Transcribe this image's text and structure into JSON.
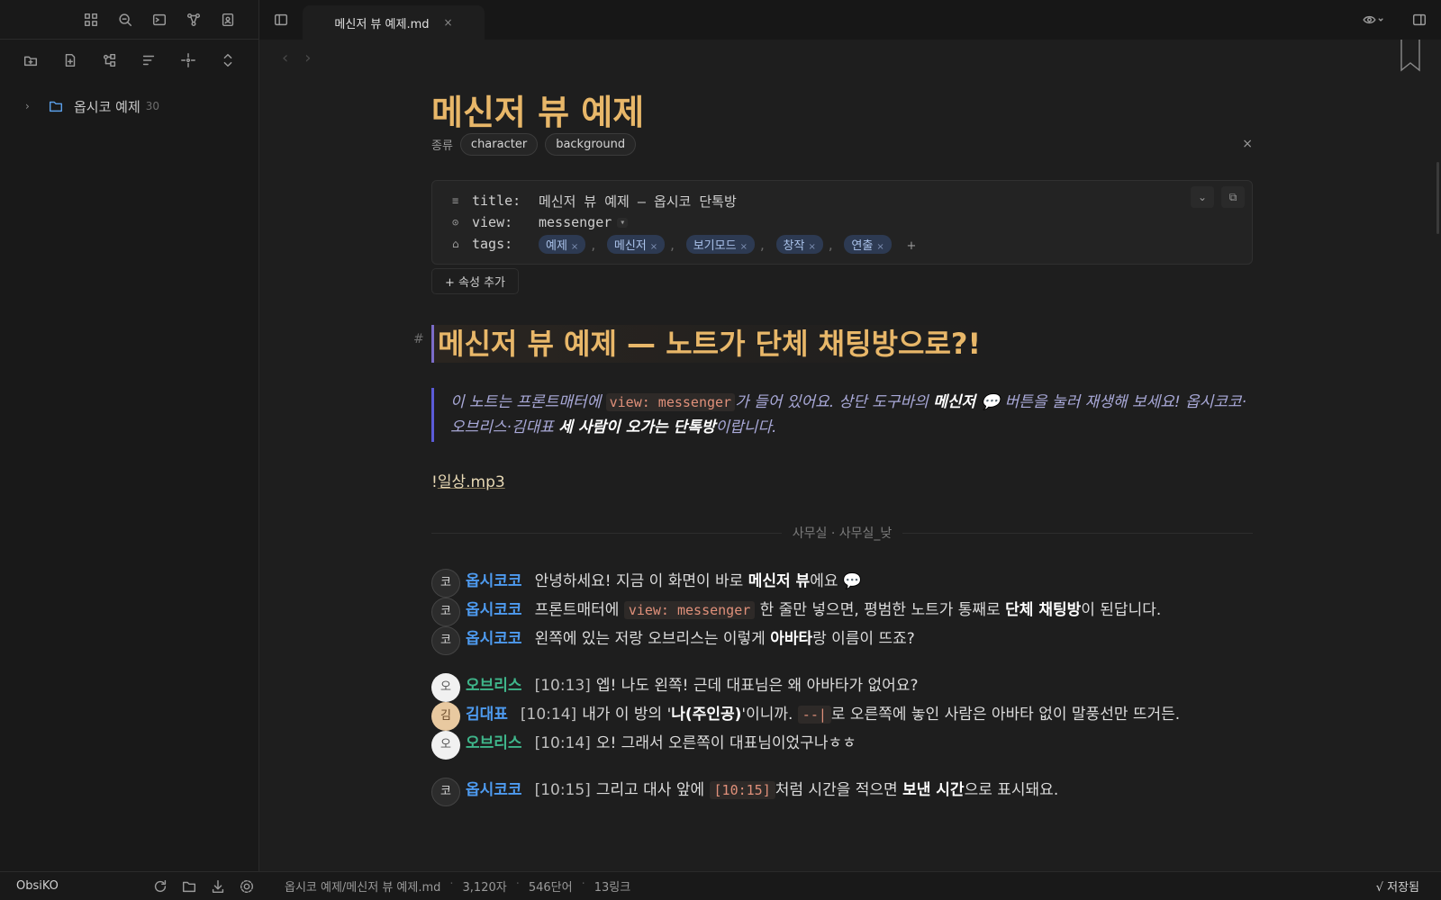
{
  "sidebar": {
    "ribbon_icons": [
      "dashboard-icon",
      "search-icon",
      "terminal-icon",
      "graph-icon",
      "profile-icon"
    ],
    "nav_icons": [
      "new-folder-icon",
      "new-note-icon",
      "canvas-icon",
      "sort-icon",
      "locate-icon",
      "collapse-icon"
    ],
    "tree": [
      {
        "name": "옵시코 예제",
        "count": "30"
      }
    ]
  },
  "tab": {
    "title": "메신저 뷰 예제.md",
    "close": "×"
  },
  "note": {
    "inline_title": "메신저 뷰 예제",
    "type_label": "종류",
    "type_pills": [
      "character",
      "background"
    ],
    "close_symbol": "×",
    "properties": {
      "title_key": "title:",
      "title_value": "메신저 뷰 예제 — 옵시코 단톡방",
      "view_key": "view:",
      "view_value": "messenger",
      "tags_key": "tags:",
      "tags": [
        "예제",
        "메신저",
        "보기모드",
        "창작",
        "연출"
      ],
      "tag_remove": "×",
      "tag_sep": ",",
      "tag_add": "+"
    },
    "add_property": "+ 속성 추가",
    "heading_hash": "#",
    "heading": "메신저 뷰 예제 — 노트가 단체 채팅방으로?!",
    "callout": {
      "part1": "이 노트는 프론트매터에 ",
      "code": "view: messenger",
      "part2": "가 들어 있어요. 상단 도구바의 ",
      "bold1": "메신저 💬",
      "part3": " 버튼을 눌러 재생해 보세요! 옵시코코·오브리스·김대표 ",
      "bold2": "세 사람이 오가는 단톡방",
      "part4": "이랍니다."
    },
    "audio": {
      "prefix": "!",
      "link": "일상.mp3"
    },
    "scene": "사무실 · 사무실_낮",
    "chat": [
      {
        "speaker": "옵시코코",
        "avatar": "코",
        "parts": [
          {
            "t": "안녕하세요! 지금 이 화면이 바로 "
          },
          {
            "b": "메신저 뷰"
          },
          {
            "t": "에요 💬"
          }
        ]
      },
      {
        "speaker": "옵시코코",
        "avatar": "코",
        "parts": [
          {
            "t": "프론트매터에 "
          },
          {
            "c": "view: messenger"
          },
          {
            "t": " 한 줄만 넣으면, 평범한 노트가 통째로 "
          },
          {
            "b": "단체 채팅방"
          },
          {
            "t": "이 된답니다."
          }
        ]
      },
      {
        "speaker": "옵시코코",
        "avatar": "코",
        "parts": [
          {
            "t": "왼쪽에 있는 저랑 오브리스는 이렇게 "
          },
          {
            "b": "아바타"
          },
          {
            "t": "랑 이름이 뜨죠?"
          }
        ]
      },
      {
        "speaker": "오브리스",
        "avatar": "오",
        "time": "[10:13]",
        "parts": [
          {
            "t": "엡! 나도 왼쪽! 근데 대표님은 왜 아바타가 없어요?"
          }
        ]
      },
      {
        "speaker": "김대표",
        "avatar": "김",
        "time": "[10:14]",
        "parts": [
          {
            "t": "내가 이 방의 '"
          },
          {
            "b": "나(주인공)"
          },
          {
            "t": "'이니까. "
          },
          {
            "c": "--|"
          },
          {
            "t": "로 오른쪽에 놓인 사람은 아바타 없이 말풍선만 뜨거든."
          }
        ]
      },
      {
        "speaker": "오브리스",
        "avatar": "오",
        "time": "[10:14]",
        "parts": [
          {
            "t": "오! 그래서 오른쪽이 대표님이었구나ㅎㅎ"
          }
        ]
      },
      {
        "speaker": "옵시코코",
        "avatar": "코",
        "time": "[10:15]",
        "parts": [
          {
            "t": "그리고 대사 앞에 "
          },
          {
            "c": "[10:15]"
          },
          {
            "t": "처럼 시간을 적으면 "
          },
          {
            "b": "보낸 시간"
          },
          {
            "t": "으로 표시돼요."
          }
        ]
      }
    ]
  },
  "status": {
    "vault": "ObsiKO",
    "path": "옵시코 예제/메신저 뷰 예제.md",
    "chars": "3,120자",
    "words": "546단어",
    "links": "13링크",
    "saved": "√ 저장됨"
  }
}
